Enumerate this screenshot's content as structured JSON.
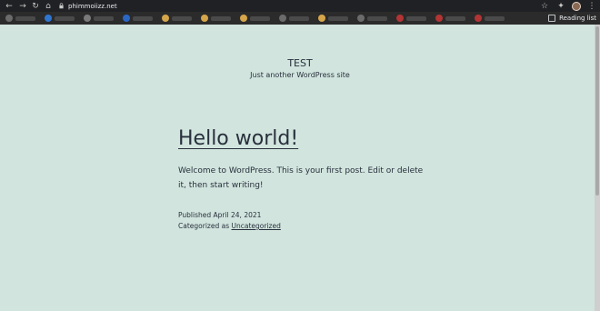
{
  "browser": {
    "url": "phimmoiizz.net",
    "reading_list_label": "Reading list",
    "bookmarks": [
      {
        "color": "#6b6b6b"
      },
      {
        "color": "#2f76d1"
      },
      {
        "color": "#7a7a7a"
      },
      {
        "color": "#2a67c5"
      },
      {
        "color": "#d6a64b"
      },
      {
        "color": "#d6a64b"
      },
      {
        "color": "#d6a64b"
      },
      {
        "color": "#6b6b6b"
      },
      {
        "color": "#d6a64b"
      },
      {
        "color": "#6b6b6b"
      },
      {
        "color": "#b23434"
      },
      {
        "color": "#b23434"
      },
      {
        "color": "#b23434"
      }
    ]
  },
  "page": {
    "site_title": "TEST",
    "site_description": "Just another WordPress site",
    "post_title": "Hello world!",
    "post_excerpt": "Welcome to WordPress. This is your first post. Edit or delete it, then start writing!",
    "published_label": "Published April 24, 2021",
    "categorized_prefix": "Categorized as",
    "category": "Uncategorized"
  },
  "colors": {
    "background": "#d1e4dd",
    "text": "#28303d"
  }
}
